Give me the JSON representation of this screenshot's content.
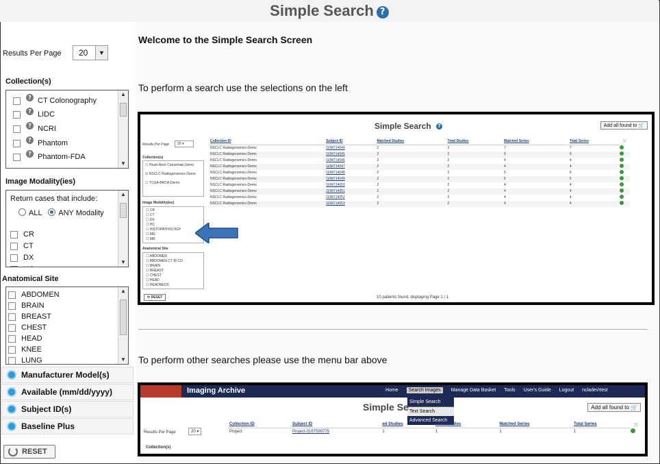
{
  "header": {
    "title": "Simple Search",
    "help_icon": "question-circle-icon"
  },
  "sidebar": {
    "results_per_page_label": "Results Per Page",
    "results_per_page_value": "20",
    "collections_heading": "Collection(s)",
    "collections": [
      "CT Colonography",
      "LIDC",
      "NCRI",
      "Phantom",
      "Phantom-FDA"
    ],
    "modality_heading": "Image Modality(ies)",
    "modality_return_label": "Return cases that include:",
    "modality_all": "ALL",
    "modality_any": "ANY Modality",
    "modalities": [
      "CR",
      "CT",
      "DX",
      "HC"
    ],
    "anatomical_heading": "Anatomical Site",
    "anatomical_sites": [
      "ABDOMEN",
      "BRAIN",
      "BREAST",
      "CHEST",
      "HEAD",
      "KNEE",
      "LUNG"
    ],
    "accordions": [
      "Manufacturer Model(s)",
      "Available (mm/dd/yyyy)",
      "Subject ID(s)",
      "Baseline Plus"
    ],
    "reset_label": "RESET"
  },
  "main": {
    "welcome": "Welcome to the Simple Search Screen",
    "instruction1": "To perform a search use the selections on the left",
    "instruction2": "To perform other searches please use the menu bar above"
  },
  "shot1": {
    "title": "Simple Search",
    "add_all": "Add all found to",
    "rpp": "Results Per Page",
    "rpp_value": "20",
    "collections_label": "Collection(s)",
    "collections": [
      "Head-Neck Cetuximab-Demo",
      "NSCLC Radiogenomics-Demo",
      "TCGA-BRCA-Demo"
    ],
    "modality_label": "Image Modality(ies)",
    "modalities": [
      "CR",
      "CT",
      "DX",
      "HC",
      "HISTOPATHOLOGY",
      "MG",
      "MR"
    ],
    "anat_label": "Anatomical Site",
    "anat": [
      "ABDOMEN",
      "ABDOMEN CT W CO",
      "BRAIN",
      "BREAST",
      "CHEST",
      "HEAD",
      "HEADNECK"
    ],
    "reset": "RESET",
    "columns": [
      "Collection ID",
      "Subject ID",
      "Matched Studies",
      "Total Studies",
      "Matched Series",
      "Total Series"
    ],
    "rows": [
      [
        "NSCLC Radiogenomics-Demo",
        "G0M714044",
        "2",
        "2",
        "7",
        "7"
      ],
      [
        "NSCLC Radiogenomics-Demo",
        "G0M714045",
        "2",
        "2",
        "9",
        "9"
      ],
      [
        "NSCLC Radiogenomics-Demo",
        "G0M714046",
        "2",
        "2",
        "4",
        "4"
      ],
      [
        "NSCLC Radiogenomics-Demo",
        "G0M714047",
        "2",
        "2",
        "4",
        "4"
      ],
      [
        "NSCLC Radiogenomics-Demo",
        "G0M714048",
        "2",
        "2",
        "5",
        "5"
      ],
      [
        "NSCLC Radiogenomics-Demo",
        "G0M714049",
        "2",
        "2",
        "5",
        "5"
      ],
      [
        "NSCLC Radiogenomics-Demo",
        "G0M714050",
        "2",
        "2",
        "4",
        "4"
      ],
      [
        "NSCLC Radiogenomics-Demo",
        "G0M714051",
        "2",
        "2",
        "4",
        "4"
      ],
      [
        "NSCLC Radiogenomics-Demo",
        "G0M714052",
        "2",
        "2",
        "4",
        "4"
      ],
      [
        "NSCLC Radiogenomics-Demo",
        "G0M714053",
        "2",
        "2",
        "4",
        "4"
      ]
    ],
    "footer": "10 patients found, displaying Page 1 / 1."
  },
  "shot2": {
    "brand": "Imaging Archive",
    "menu": [
      "Home",
      "Search Images",
      "Manage Data Basket",
      "Tools",
      "User's Guide",
      "Logout",
      "ncladev\\test"
    ],
    "dropdown": [
      "Simple Search",
      "Text Search",
      "Advanced Search"
    ],
    "title": "Simple Se",
    "add_all": "Add all found to",
    "rpp": "Results Per Page",
    "rpp_value": "20",
    "collections_label": "Collection(s)",
    "columns": [
      "Collection ID",
      "Subject ID",
      "ed Studies",
      "Total Studies",
      "Matched Series",
      "Total Series"
    ],
    "row": [
      "Project",
      "Project-3167590775",
      "1",
      "1",
      "1",
      "1"
    ]
  },
  "colors": {
    "accent": "#2d6ea8",
    "arrow": "#3b74b8",
    "menu_bg": "#1c2a55"
  }
}
